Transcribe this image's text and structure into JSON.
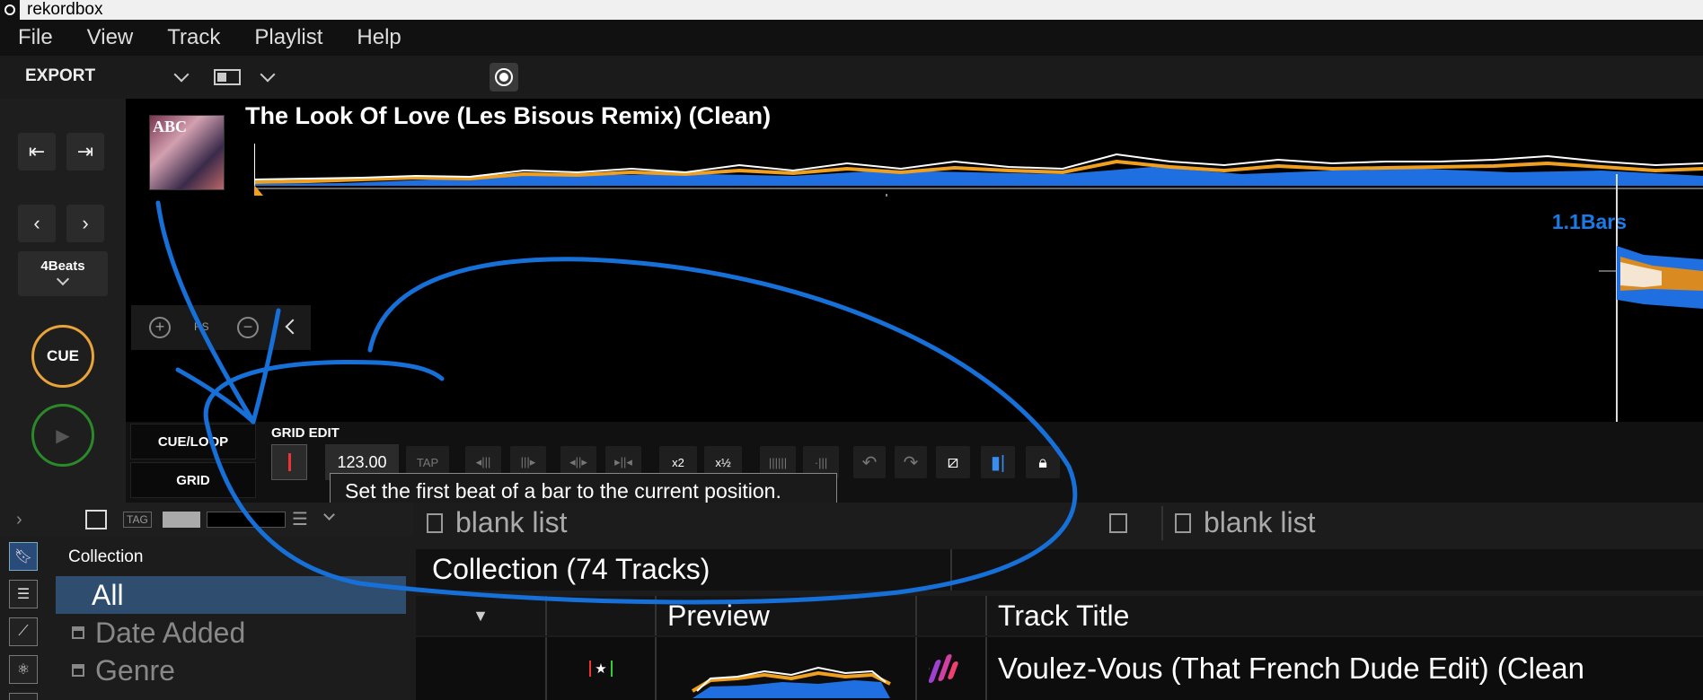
{
  "window": {
    "title": "rekordbox"
  },
  "menu": {
    "file": "File",
    "view": "View",
    "track": "Track",
    "playlist": "Playlist",
    "help": "Help"
  },
  "toolbar": {
    "mode": "EXPORT"
  },
  "deck": {
    "beat_jump": "4Beats",
    "cue": "CUE",
    "track_title": "The Look Of Love (Les Bisous Remix) (Clean)",
    "album_art_text": "ABC",
    "bars_readout": "1.1Bars",
    "zoom_label": "RS"
  },
  "grid_panel": {
    "tab_cue_loop": "CUE/LOOP",
    "tab_grid": "GRID",
    "section_label": "GRID EDIT",
    "bpm": "123.00",
    "tap": "TAP",
    "x2": "x2",
    "half": "x½",
    "tooltip": "Set the first beat of a bar to the current position."
  },
  "browser": {
    "tag_label": "TAG",
    "tree_header": "Collection",
    "tree_items": [
      {
        "label": "All",
        "selected": true
      },
      {
        "label": "Date Added",
        "locked": true
      },
      {
        "label": "Genre",
        "locked": true
      }
    ],
    "list_tab_left": "blank list",
    "list_tab_right": "blank list",
    "collection_title": "Collection (74 Tracks)",
    "columns": {
      "preview": "Preview",
      "track_title": "Track Title"
    },
    "rows": [
      {
        "title": "Voulez-Vous (That French Dude Edit) (Clean"
      }
    ]
  },
  "colors": {
    "accent_blue": "#1a7be6",
    "cue_orange": "#e8a33a",
    "play_green": "#2a8a2a",
    "annotation_blue": "#1670d8"
  }
}
